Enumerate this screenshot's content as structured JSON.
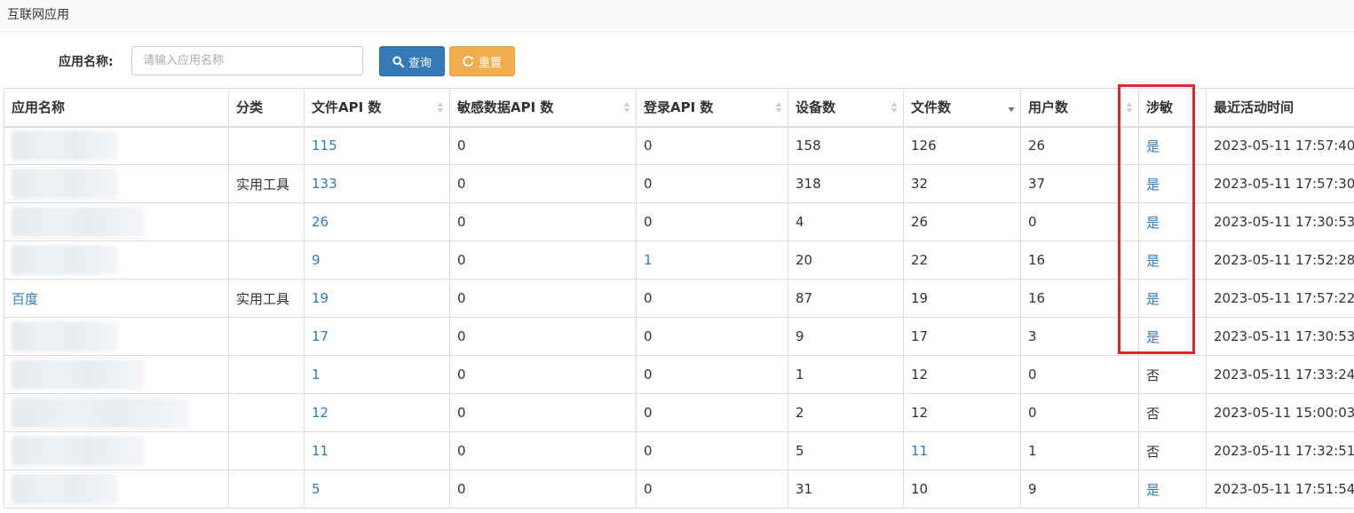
{
  "panel": {
    "title": "互联网应用"
  },
  "search": {
    "label": "应用名称:",
    "placeholder": "请输入应用名称",
    "query_label": "查询",
    "reset_label": "重置"
  },
  "table": {
    "columns": [
      "应用名称",
      "分类",
      "文件API 数",
      "敏感数据API 数",
      "登录API 数",
      "设备数",
      "文件数",
      "用户数",
      "涉敏",
      "最近活动时间"
    ],
    "rows": [
      {
        "name": "",
        "category": "",
        "file_api": "115",
        "sensitive_api": "0",
        "login_api": "0",
        "devices": "158",
        "files": "126",
        "users": "26",
        "sensitive": "是",
        "last_active": "2023-05-11 17:57:40"
      },
      {
        "name": "",
        "category": "实用工具",
        "file_api": "133",
        "sensitive_api": "0",
        "login_api": "0",
        "devices": "318",
        "files": "32",
        "users": "37",
        "sensitive": "是",
        "last_active": "2023-05-11 17:57:30"
      },
      {
        "name": "",
        "category": "",
        "file_api": "26",
        "sensitive_api": "0",
        "login_api": "0",
        "devices": "4",
        "files": "26",
        "users": "0",
        "sensitive": "是",
        "last_active": "2023-05-11 17:30:53"
      },
      {
        "name": "",
        "category": "",
        "file_api": "9",
        "sensitive_api": "0",
        "login_api": "1",
        "devices": "20",
        "files": "22",
        "users": "16",
        "sensitive": "是",
        "last_active": "2023-05-11 17:52:28"
      },
      {
        "name": "百度",
        "category": "实用工具",
        "file_api": "19",
        "sensitive_api": "0",
        "login_api": "0",
        "devices": "87",
        "files": "19",
        "users": "16",
        "sensitive": "是",
        "last_active": "2023-05-11 17:57:22"
      },
      {
        "name": "",
        "category": "",
        "file_api": "17",
        "sensitive_api": "0",
        "login_api": "0",
        "devices": "9",
        "files": "17",
        "users": "3",
        "sensitive": "是",
        "last_active": "2023-05-11 17:30:53"
      },
      {
        "name": "",
        "category": "",
        "file_api": "1",
        "sensitive_api": "0",
        "login_api": "0",
        "devices": "1",
        "files": "12",
        "users": "0",
        "sensitive": "否",
        "last_active": "2023-05-11 17:33:24"
      },
      {
        "name": "",
        "category": "",
        "file_api": "12",
        "sensitive_api": "0",
        "login_api": "0",
        "devices": "2",
        "files": "12",
        "users": "0",
        "sensitive": "否",
        "last_active": "2023-05-11 15:00:03"
      },
      {
        "name": "",
        "category": "",
        "file_api": "11",
        "sensitive_api": "0",
        "login_api": "0",
        "devices": "5",
        "files": "11",
        "users": "1",
        "sensitive": "否",
        "last_active": "2023-05-11 17:32:51"
      },
      {
        "name": "",
        "category": "",
        "file_api": "5",
        "sensitive_api": "0",
        "login_api": "0",
        "devices": "31",
        "files": "10",
        "users": "9",
        "sensitive": "是",
        "last_active": "2023-05-11 17:51:54"
      }
    ]
  },
  "colors": {
    "link": "#337ab7",
    "query_button": "#337ab7",
    "reset_button": "#f0ad4e",
    "highlight": "#e0262a"
  },
  "icons": {
    "query": "search-icon",
    "reset": "refresh-icon",
    "sort": "sort-icon",
    "sort_desc": "sort-desc-icon"
  }
}
